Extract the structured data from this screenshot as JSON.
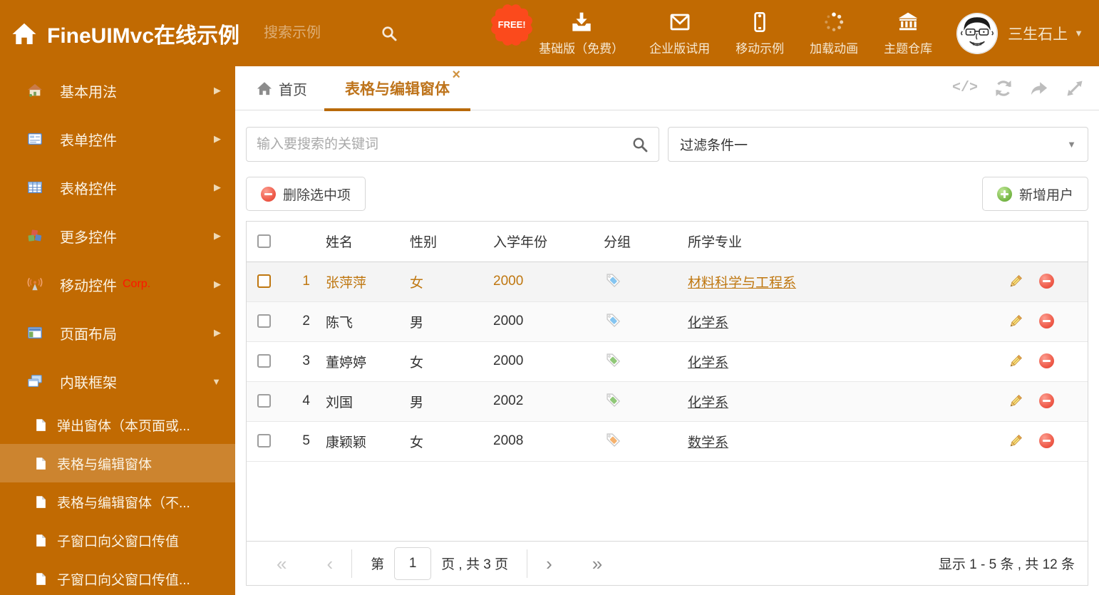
{
  "theme": {
    "header_bg": "#C16A02",
    "active_tab_color": "#BE741C",
    "selected_row_color": "#BF7710",
    "free_badge_bg": "#FB4A1C",
    "delete_icon_color": "#EF5B4A",
    "add_icon_color": "#7CBB4C",
    "tag_colors": {
      "blue": "#85C5F0",
      "green": "#90C878",
      "orange": "#F5B26E"
    }
  },
  "header": {
    "title": "FineUIMvc在线示例",
    "search_placeholder": "搜索示例",
    "free_badge": "FREE!",
    "actions": [
      {
        "label": "基础版（免费）",
        "icon": "download-icon"
      },
      {
        "label": "企业版试用",
        "icon": "envelope-icon"
      },
      {
        "label": "移动示例",
        "icon": "mobile-icon"
      },
      {
        "label": "加载动画",
        "icon": "spinner-icon"
      },
      {
        "label": "主题仓库",
        "icon": "bank-icon"
      }
    ],
    "user": {
      "name": "三生石上"
    }
  },
  "sidebar": {
    "items": [
      {
        "label": "基本用法",
        "icon": "home-icon"
      },
      {
        "label": "表单控件",
        "icon": "form-icon"
      },
      {
        "label": "表格控件",
        "icon": "table-icon"
      },
      {
        "label": "更多控件",
        "icon": "cubes-icon"
      },
      {
        "label": "移动控件",
        "badge": "Corp.",
        "icon": "antenna-icon"
      },
      {
        "label": "页面布局",
        "icon": "layout-icon"
      },
      {
        "label": "内联框架",
        "icon": "frames-icon",
        "expanded": true
      }
    ],
    "subitems": [
      {
        "label": "弹出窗体（本页面或..."
      },
      {
        "label": "表格与编辑窗体",
        "active": true
      },
      {
        "label": "表格与编辑窗体（不..."
      },
      {
        "label": "子窗口向父窗口传值"
      },
      {
        "label": "子窗口向父窗口传值..."
      }
    ]
  },
  "tabs": {
    "home_label": "首页",
    "active_label": "表格与编辑窗体"
  },
  "filters": {
    "search_placeholder": "输入要搜索的关键词",
    "filter_value": "过滤条件一"
  },
  "toolbar": {
    "delete_label": "删除选中项",
    "add_label": "新增用户"
  },
  "grid": {
    "columns": [
      "姓名",
      "性别",
      "入学年份",
      "分组",
      "所学专业"
    ],
    "rows": [
      {
        "num": "1",
        "name": "张萍萍",
        "gender": "女",
        "year": "2000",
        "tag_color": "blue",
        "major": "材料科学与工程系",
        "selected": true
      },
      {
        "num": "2",
        "name": "陈飞",
        "gender": "男",
        "year": "2000",
        "tag_color": "blue",
        "major": "化学系"
      },
      {
        "num": "3",
        "name": "董婷婷",
        "gender": "女",
        "year": "2000",
        "tag_color": "green",
        "major": "化学系"
      },
      {
        "num": "4",
        "name": "刘国",
        "gender": "男",
        "year": "2002",
        "tag_color": "green",
        "major": "化学系"
      },
      {
        "num": "5",
        "name": "康颖颖",
        "gender": "女",
        "year": "2008",
        "tag_color": "orange",
        "major": "数学系"
      }
    ]
  },
  "pagination": {
    "page_prefix": "第",
    "page_value": "1",
    "page_suffix": "页 , 共 3 页",
    "summary": "显示 1 - 5 条 , 共 12 条"
  }
}
